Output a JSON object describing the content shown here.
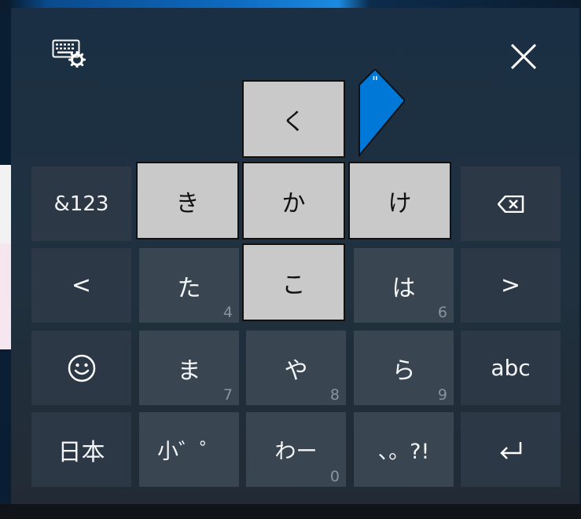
{
  "colors": {
    "panel_bg": "#1f3140",
    "key_bg": "#3a4552",
    "key_dark_bg": "#2c3845",
    "flick_bg": "#c9c9c9",
    "accent": "#0078d7",
    "key_text": "#f4f6f8",
    "hint_text": "#8b949c"
  },
  "header": {
    "settings_icon": "keyboard-settings-icon",
    "close_icon": "close-icon"
  },
  "flick_popup": {
    "up": "く",
    "left": "き",
    "center": "か",
    "right": "け",
    "down": "こ",
    "dakuten_hint": "\""
  },
  "keys": {
    "symbols": "&123",
    "backspace_icon": "backspace-icon",
    "left_arrow": "<",
    "ta": {
      "label": "た",
      "num": "4"
    },
    "ha": {
      "label": "は",
      "num": "6"
    },
    "right_arrow": ">",
    "emoji_icon": "emoji-icon",
    "ma": {
      "label": "ま",
      "num": "7"
    },
    "ya": {
      "label": "や",
      "num": "8"
    },
    "ra": {
      "label": "ら",
      "num": "9"
    },
    "abc": "abc",
    "japanese": "日本",
    "small_dakuten": "小゛゜",
    "wa": {
      "label": "わー",
      "num": "0"
    },
    "punct": "、。?!",
    "enter_icon": "enter-icon"
  }
}
